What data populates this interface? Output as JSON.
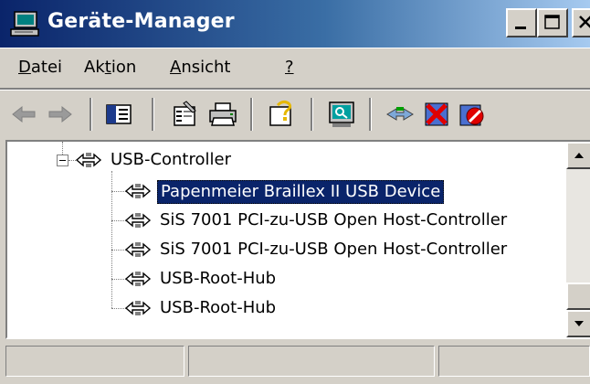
{
  "window": {
    "title": "Geräte-Manager"
  },
  "menu": {
    "items": [
      {
        "label": "Datei",
        "accel_index": 0
      },
      {
        "label": "Aktion",
        "accel_index": 2
      },
      {
        "label": "Ansicht",
        "accel_index": 0
      },
      {
        "label": "?",
        "accel_index": 0
      }
    ]
  },
  "toolbar": {
    "buttons": [
      "back-arrow-icon",
      "forward-arrow-icon",
      "show-hide-console-tree-icon",
      "properties-icon",
      "print-icon",
      "help-icon",
      "scan-hardware-icon",
      "update-driver-icon",
      "uninstall-icon",
      "disable-icon"
    ]
  },
  "tree": {
    "category": "USB-Controller",
    "devices": [
      {
        "label": "Papenmeier Braillex II USB Device",
        "selected": true
      },
      {
        "label": "SiS 7001 PCI-zu-USB Open Host-Controller",
        "selected": false
      },
      {
        "label": "SiS 7001 PCI-zu-USB Open Host-Controller",
        "selected": false
      },
      {
        "label": "USB-Root-Hub",
        "selected": false
      },
      {
        "label": "USB-Root-Hub",
        "selected": false
      }
    ]
  },
  "colors": {
    "titlebar_start": "#0a246a",
    "titlebar_end": "#a6caf0",
    "window_face": "#d4d0c8",
    "selection": "#0a246a"
  }
}
